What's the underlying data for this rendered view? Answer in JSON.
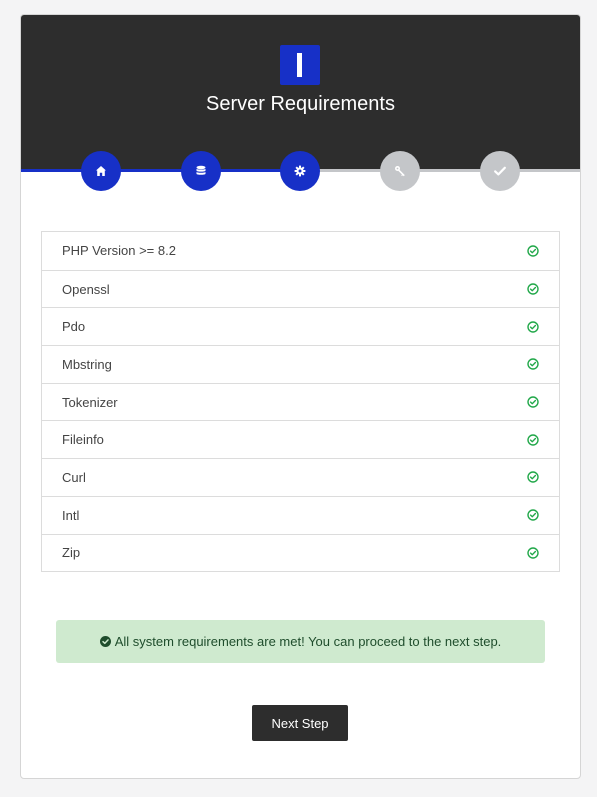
{
  "header": {
    "title": "Server Requirements",
    "logo_icon": "installer-logo-icon"
  },
  "steps": [
    {
      "icon": "home-icon",
      "status": "complete"
    },
    {
      "icon": "database-icon",
      "status": "complete"
    },
    {
      "icon": "gear-icon",
      "status": "current"
    },
    {
      "icon": "key-icon",
      "status": "pending"
    },
    {
      "icon": "check-icon",
      "status": "pending"
    }
  ],
  "requirements": [
    {
      "label": "PHP Version >= 8.2",
      "met": true
    },
    {
      "label": "Openssl",
      "met": true
    },
    {
      "label": "Pdo",
      "met": true
    },
    {
      "label": "Mbstring",
      "met": true
    },
    {
      "label": "Tokenizer",
      "met": true
    },
    {
      "label": "Fileinfo",
      "met": true
    },
    {
      "label": "Curl",
      "met": true
    },
    {
      "label": "Intl",
      "met": true
    },
    {
      "label": "Zip",
      "met": true
    }
  ],
  "alert": {
    "message": "All system requirements are met! You can proceed to the next step."
  },
  "buttons": {
    "next_label": "Next Step"
  },
  "colors": {
    "accent": "#1730c7",
    "header_bg": "#2d2d2d",
    "pending": "#c4c6c9",
    "success": "#22a84a",
    "alert_bg": "#cfeacf"
  }
}
